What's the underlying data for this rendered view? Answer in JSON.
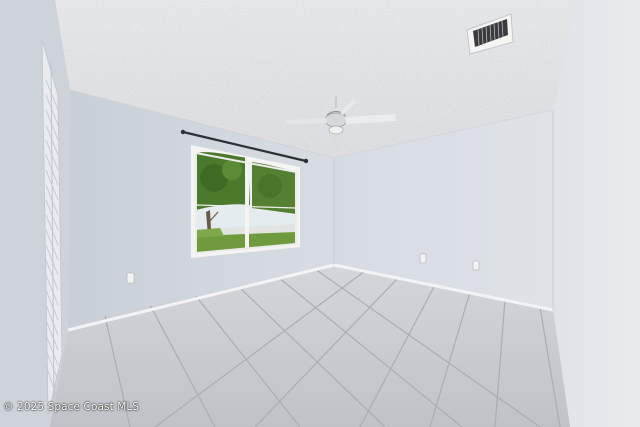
{
  "photo": {
    "watermark": "© 2025 Space Coast MLS"
  },
  "colors": {
    "ceiling": "#e9eaec",
    "wall_back": "#dde1e7",
    "wall_left": "#d3d8df",
    "wall_right": "#e4e7eb",
    "floor_tile": "#c6cacf",
    "grout": "#a9adb2",
    "foliage": "#4f7a2e",
    "lawn": "#6f9a3e",
    "sky": "#dfe9ee",
    "window_frame": "#f4f4f2"
  }
}
